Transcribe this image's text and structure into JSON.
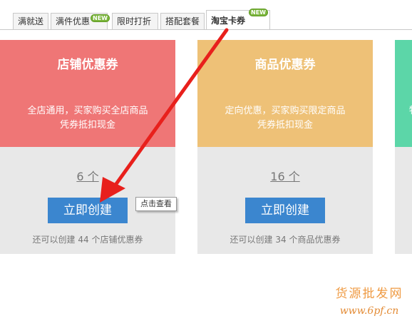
{
  "tabs": [
    {
      "label": "满就送",
      "active": false
    },
    {
      "label": "满件优惠",
      "badge": "NEW",
      "active": false
    },
    {
      "label": "限时打折",
      "active": false
    },
    {
      "label": "搭配套餐",
      "active": false
    },
    {
      "label": "淘宝卡券",
      "badge": "NEW",
      "active": true
    }
  ],
  "cards": [
    {
      "title": "店铺优惠券",
      "desc_line1": "全店通用，买家购买全店商品",
      "desc_line2": "凭券抵扣现金",
      "count": "6 个",
      "button": "立即创建",
      "hint": "还可以创建 44 个店铺优惠券",
      "color": "#ef7676"
    },
    {
      "title": "商品优惠券",
      "desc_line1": "定向优惠，买家购买限定商品",
      "desc_line2": "凭券抵扣现金",
      "count": "16 个",
      "button": "立即创建",
      "hint": "还可以创建 34 个商品优惠券",
      "color": "#eec177"
    },
    {
      "desc_fragment": "物",
      "color": "#5cd6a8"
    }
  ],
  "tooltip": "点击查看",
  "watermark": {
    "title": "货源批发网",
    "url": "www.6pf.cn"
  },
  "colors": {
    "accent_blue": "#3b86cf",
    "arrow_red": "#e8201c",
    "badge_green": "#7ab53b"
  }
}
